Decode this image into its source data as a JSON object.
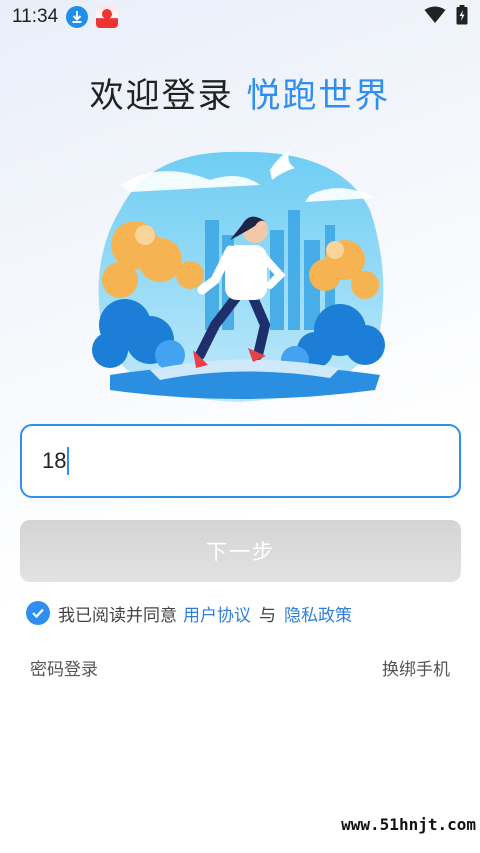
{
  "status": {
    "time": "11:34",
    "icons": [
      "download-icon",
      "app-notification-icon",
      "wifi-icon",
      "battery-charging-icon"
    ]
  },
  "header": {
    "title_prefix": "欢迎登录",
    "title_brand": "悦跑世界"
  },
  "login": {
    "phone_value": "18",
    "next_label": "下一步",
    "agree_text": "我已阅读并同意",
    "user_agreement": "用户协议",
    "and_text": "与",
    "privacy_policy": "隐私政策",
    "password_login": "密码登录",
    "change_phone": "换绑手机"
  },
  "watermark": "www.51hnjt.com",
  "colors": {
    "accent": "#2f8ef0",
    "button_disabled": "#d8d8d8"
  }
}
